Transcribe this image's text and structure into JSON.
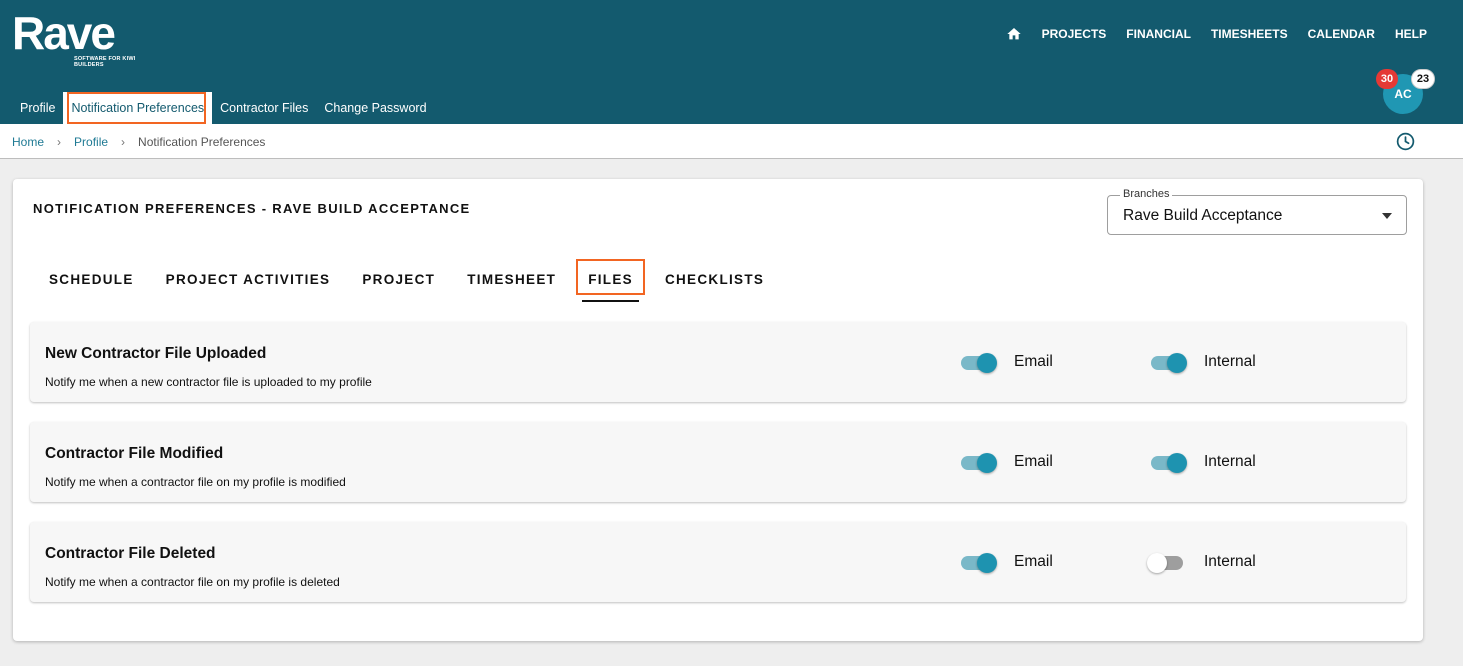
{
  "header": {
    "logo_text": "Rave",
    "logo_tagline": "SOFTWARE FOR KIWI BUILDERS",
    "nav": [
      "PROJECTS",
      "FINANCIAL",
      "TIMESHEETS",
      "CALENDAR",
      "HELP"
    ],
    "avatar_initials": "AC",
    "badge_red": "30",
    "badge_white": "23"
  },
  "subtabs": [
    {
      "label": "Profile"
    },
    {
      "label": "Notification Preferences"
    },
    {
      "label": "Contractor Files"
    },
    {
      "label": "Change Password"
    }
  ],
  "breadcrumb": {
    "home": "Home",
    "profile": "Profile",
    "current": "Notification Preferences"
  },
  "card": {
    "title": "NOTIFICATION PREFERENCES - RAVE BUILD ACCEPTANCE",
    "branches_label": "Branches",
    "branches_value": "Rave Build Acceptance",
    "tabs": [
      "SCHEDULE",
      "PROJECT ACTIVITIES",
      "PROJECT",
      "TIMESHEET",
      "FILES",
      "CHECKLISTS"
    ],
    "active_tab": "FILES",
    "email_label": "Email",
    "internal_label": "Internal",
    "rows": [
      {
        "title": "New Contractor File Uploaded",
        "desc": "Notify me when a new contractor file is uploaded to my profile",
        "email": true,
        "internal": true
      },
      {
        "title": "Contractor File Modified",
        "desc": "Notify me when a contractor file on my profile is modified",
        "email": true,
        "internal": true
      },
      {
        "title": "Contractor File Deleted",
        "desc": "Notify me when a contractor file on my profile is deleted",
        "email": true,
        "internal": false
      }
    ]
  },
  "colors": {
    "header_bg": "#135a6e",
    "accent": "#1e93b0",
    "highlight_outline": "#f26522"
  }
}
